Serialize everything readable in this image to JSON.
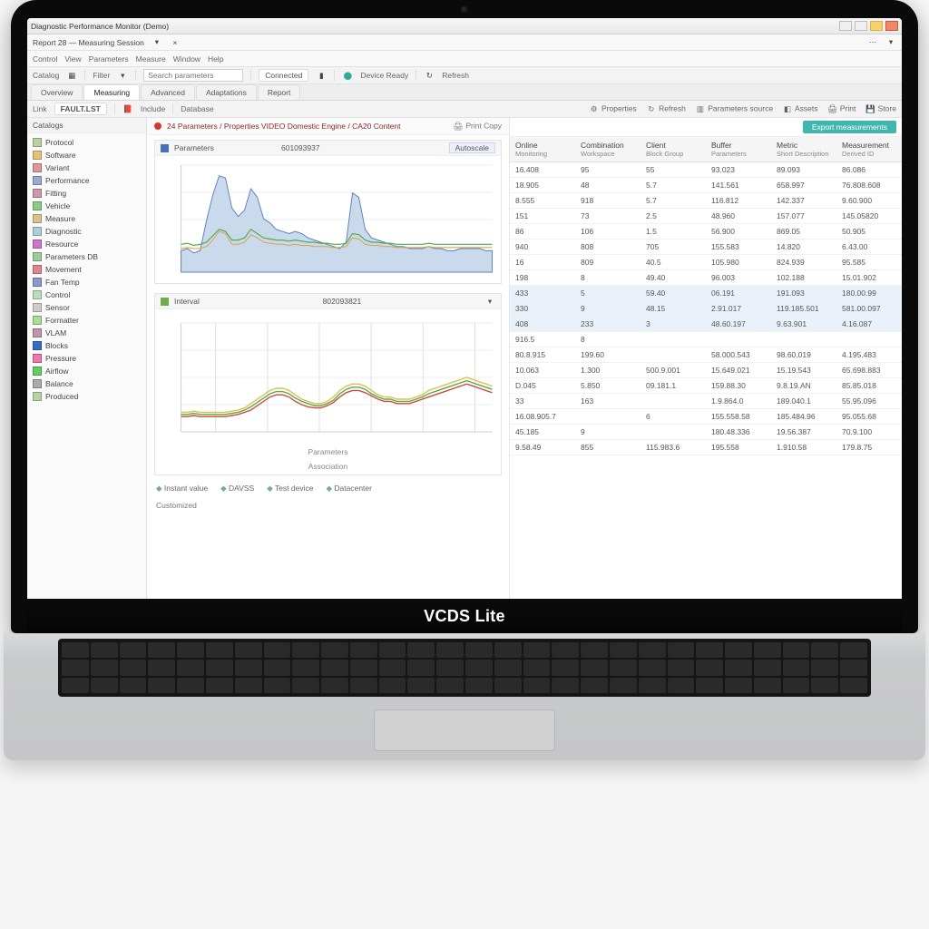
{
  "window": {
    "title": "Diagnostic Performance Monitor (Demo)",
    "subtitle": "Report 28 — Measuring Session"
  },
  "tabs": [
    "Overview",
    "Measuring",
    "Advanced",
    "Adaptations",
    "Report"
  ],
  "menubar": [
    "Control",
    "View",
    "Parameters",
    "Measure",
    "Window",
    "Help"
  ],
  "toolbarA": {
    "category_label": "Catalog",
    "filter_label": "Filter",
    "search_placeholder": "Search parameters",
    "status": "Connected",
    "device": "Device Ready"
  },
  "toolbarB": {
    "link_label": "Link",
    "docname": "FAULT.LST",
    "database": "Database",
    "tools": [
      "Properties",
      "Refresh",
      "Parameters source",
      "Assets",
      "Print",
      "Store"
    ]
  },
  "sidebar": {
    "header": "Catalogs",
    "items": [
      "Protocol",
      "Software",
      "Variant",
      "Performance",
      "Fitting",
      "Vehicle",
      "Measure",
      "Diagnostic",
      "Resource",
      "Parameters DB",
      "Movement",
      "Fan Temp",
      "Control",
      "Sensor",
      "Formatter",
      "VLAM",
      "Blocks",
      "Pressure",
      "Airflow",
      "Balance",
      "Produced"
    ]
  },
  "panel": {
    "title": "24 Parameters / Properties VIDEO Domestic Engine / CA20 Content",
    "aux": "Print Copy"
  },
  "chart1": {
    "head_label": "Parameters",
    "head_mid": "601093937",
    "pill": "Autoscale"
  },
  "chart2": {
    "head_label": "Interval",
    "head_mid": "802093821",
    "foot1": "Parameters",
    "foot2": "Association"
  },
  "legend": [
    "Instant value",
    "DAVSS",
    "Test device",
    "Datacenter"
  ],
  "outer_foot": "Customized",
  "right": {
    "button": "Export measurements"
  },
  "grid": {
    "columns": [
      {
        "h": "Online",
        "s": "Monitoring"
      },
      {
        "h": "Combination",
        "s": "Workspace"
      },
      {
        "h": "Client",
        "s": "Block Group"
      },
      {
        "h": "Buffer",
        "s": "Parameters"
      },
      {
        "h": "Metric",
        "s": "Short Description"
      },
      {
        "h": "Measurement",
        "s": "Derived ID"
      }
    ],
    "rows": [
      [
        "16.408",
        "95",
        "55",
        "93.023",
        "89.093",
        "86.086"
      ],
      [
        "18.905",
        "48",
        "5.7",
        "141.561",
        "658.997",
        "76.808.608"
      ],
      [
        "8.555",
        "918",
        "5.7",
        "116.812",
        "142.337",
        "9.60.900"
      ],
      [
        "151",
        "73",
        "2.5",
        "48.960",
        "157.077",
        "145.05820"
      ],
      [
        "86",
        "106",
        "1.5",
        "56.900",
        "869.05",
        "50.905"
      ],
      [
        "940",
        "808",
        "705",
        "155.583",
        "14.820",
        "6.43.00"
      ],
      [
        "16",
        "809",
        "40.5",
        "105.980",
        "824.939",
        "95.585"
      ],
      [
        "198",
        "8",
        "49.40",
        "96.003",
        "102.188",
        "15.01.902"
      ],
      [
        "433",
        "5",
        "59.40",
        "06.191",
        "191.093",
        "180.00.99"
      ],
      [
        "330",
        "9",
        "48.15",
        "2.91.017",
        "119.185.501",
        "581.00.097"
      ],
      [
        "408",
        "233",
        "3",
        "48.60.197",
        "9.63.901",
        "4.16.087"
      ],
      [
        "916.5",
        "8",
        "",
        "",
        "",
        ""
      ],
      [
        "80.8.915",
        "199.60",
        "",
        "58.000.543",
        "98.60.019",
        "4.195.483"
      ],
      [
        "10.063",
        "1.300",
        "500.9.001",
        "15.649.021",
        "15.19.543",
        "65.698.883"
      ],
      [
        "D.045",
        "5.850",
        "09.181.1",
        "159.88.30",
        "9.8.19.AN",
        "85.85.018"
      ],
      [
        "33",
        "163",
        "",
        "1.9.864.0",
        "189.040.1",
        "55.95.096"
      ],
      [
        "16.08.905.7",
        "",
        "6",
        "155.558.58",
        "185.484.96",
        "95.055.68"
      ],
      [
        "45.185",
        "9",
        "",
        "180.48.336",
        "19.56.387",
        "70.9.100"
      ],
      [
        "9.58.49",
        "855",
        "115.983.6",
        "195.558",
        "1.910.58",
        "179.8.75"
      ]
    ],
    "highlight": [
      8,
      9,
      10
    ]
  },
  "brand": "VCDS Lite",
  "chart_data": [
    {
      "type": "line",
      "title": "Parameters",
      "ylim": [
        0,
        100
      ],
      "x": [
        0,
        1,
        2,
        3,
        4,
        5,
        6,
        7,
        8,
        9,
        10,
        11,
        12,
        13,
        14,
        15,
        16,
        17,
        18,
        19,
        20,
        21,
        22,
        23,
        24,
        25,
        26,
        27,
        28,
        29,
        30,
        31,
        32,
        33,
        34,
        35,
        36,
        37,
        38,
        39,
        40,
        41,
        42,
        43,
        44,
        45,
        46,
        47,
        48,
        49
      ],
      "series": [
        {
          "name": "area",
          "values": [
            20,
            22,
            18,
            20,
            48,
            72,
            90,
            88,
            60,
            52,
            58,
            78,
            70,
            50,
            46,
            40,
            38,
            36,
            38,
            36,
            32,
            30,
            28,
            26,
            24,
            22,
            28,
            74,
            70,
            40,
            32,
            30,
            28,
            26,
            24,
            24,
            22,
            22,
            22,
            24,
            22,
            22,
            20,
            20,
            22,
            22,
            22,
            22,
            20,
            20
          ]
        },
        {
          "name": "line_green",
          "values": [
            26,
            27,
            25,
            26,
            28,
            34,
            40,
            38,
            30,
            30,
            32,
            40,
            36,
            32,
            31,
            30,
            30,
            29,
            30,
            29,
            28,
            28,
            27,
            27,
            26,
            26,
            27,
            36,
            35,
            30,
            28,
            28,
            27,
            27,
            26,
            26,
            26,
            26,
            26,
            27,
            26,
            26,
            26,
            26,
            26,
            26,
            26,
            26,
            26,
            26
          ]
        },
        {
          "name": "line_orange",
          "values": [
            22,
            23,
            22,
            22,
            24,
            30,
            38,
            36,
            26,
            26,
            28,
            35,
            32,
            28,
            27,
            26,
            26,
            25,
            26,
            25,
            25,
            24,
            24,
            24,
            23,
            23,
            24,
            32,
            31,
            26,
            25,
            25,
            24,
            24,
            23,
            23,
            23,
            23,
            23,
            24,
            23,
            23,
            23,
            23,
            23,
            23,
            23,
            23,
            23,
            23
          ]
        }
      ]
    },
    {
      "type": "line",
      "title": "Interval",
      "ylim": [
        0,
        100
      ],
      "x": [
        0,
        1,
        2,
        3,
        4,
        5,
        6,
        7,
        8,
        9,
        10,
        11,
        12,
        13,
        14,
        15,
        16,
        17,
        18,
        19,
        20,
        21,
        22,
        23,
        24,
        25,
        26,
        27,
        28,
        29,
        30,
        31,
        32,
        33,
        34,
        35,
        36,
        37,
        38,
        39,
        40,
        41,
        42,
        43,
        44,
        45,
        46,
        47,
        48,
        49
      ],
      "series": [
        {
          "name": "yellow",
          "values": [
            18,
            18,
            19,
            18,
            18,
            18,
            18,
            18,
            19,
            20,
            22,
            26,
            30,
            34,
            38,
            40,
            40,
            38,
            34,
            30,
            28,
            26,
            26,
            28,
            32,
            38,
            42,
            44,
            44,
            42,
            38,
            34,
            32,
            32,
            30,
            30,
            30,
            32,
            34,
            38,
            40,
            42,
            44,
            46,
            48,
            50,
            48,
            46,
            44,
            42
          ]
        },
        {
          "name": "green",
          "values": [
            16,
            16,
            17,
            16,
            16,
            16,
            16,
            16,
            17,
            18,
            20,
            23,
            27,
            31,
            35,
            37,
            37,
            35,
            31,
            28,
            26,
            24,
            24,
            26,
            29,
            35,
            39,
            41,
            41,
            39,
            35,
            32,
            30,
            30,
            28,
            28,
            28,
            30,
            32,
            35,
            37,
            39,
            41,
            43,
            45,
            47,
            45,
            43,
            41,
            39
          ]
        },
        {
          "name": "red",
          "values": [
            14,
            14,
            15,
            14,
            14,
            14,
            14,
            14,
            15,
            16,
            18,
            20,
            24,
            28,
            32,
            34,
            34,
            32,
            28,
            25,
            23,
            22,
            22,
            24,
            27,
            32,
            36,
            38,
            38,
            36,
            33,
            30,
            28,
            28,
            26,
            26,
            26,
            28,
            30,
            32,
            34,
            36,
            38,
            40,
            42,
            44,
            42,
            40,
            38,
            36
          ]
        }
      ]
    }
  ]
}
